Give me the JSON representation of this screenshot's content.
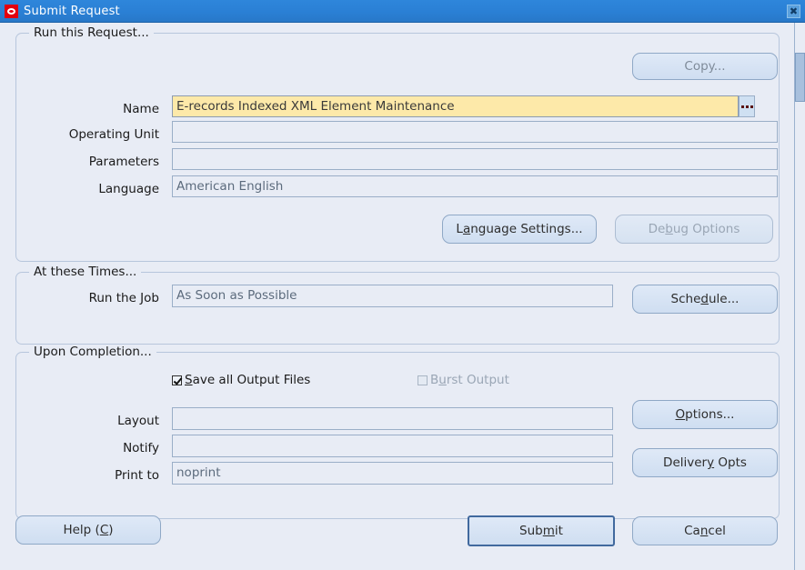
{
  "window": {
    "title": "Submit Request",
    "icon": "oracle-logo-icon",
    "close_label": "✖"
  },
  "run_request": {
    "legend": "Run this Request...",
    "copy_button": "Copy...",
    "fields": [
      {
        "label": "Name",
        "value": "E-records Indexed XML Element Maintenance",
        "focused": true,
        "has_lov": true
      },
      {
        "label": "Operating Unit",
        "value": "",
        "focused": false,
        "has_lov": false
      },
      {
        "label": "Parameters",
        "value": "",
        "focused": false,
        "has_lov": false
      },
      {
        "label": "Language",
        "value": "American English",
        "focused": false,
        "has_lov": false
      }
    ],
    "language_settings_button": {
      "pre": "L",
      "mnemonic": "a",
      "post": "nguage Settings..."
    },
    "debug_options_button": {
      "pre": "De",
      "mnemonic": "b",
      "post": "ug Options",
      "enabled": false
    }
  },
  "at_these_times": {
    "legend": "At these Times...",
    "run_the_job_label": "Run the Job",
    "run_the_job_value": "As Soon as Possible",
    "schedule_button": {
      "pre": "Sche",
      "mnemonic": "d",
      "post": "ule..."
    }
  },
  "upon_completion": {
    "legend": "Upon Completion...",
    "save_all_output_files": {
      "pre": "",
      "mnemonic": "S",
      "post": "ave all Output Files",
      "checked": true,
      "enabled": true
    },
    "burst_output": {
      "pre": "B",
      "mnemonic": "u",
      "post": "rst Output",
      "checked": false,
      "enabled": false
    },
    "fields": [
      {
        "label": "Layout",
        "value": ""
      },
      {
        "label": "Notify",
        "value": ""
      },
      {
        "label": "Print to",
        "value": "noprint"
      }
    ],
    "options_button": {
      "pre": "",
      "mnemonic": "O",
      "post": "ptions..."
    },
    "delivery_opts_button": {
      "pre": "Deliver",
      "mnemonic": "y",
      "post": " Opts"
    }
  },
  "footer": {
    "help_button": {
      "pre": "Help (",
      "mnemonic": "C",
      "post": ")"
    },
    "submit_button": {
      "pre": "Sub",
      "mnemonic": "m",
      "post": "it"
    },
    "cancel_button": {
      "pre": "Ca",
      "mnemonic": "n",
      "post": "cel"
    }
  },
  "colors": {
    "titlebar": "#2a7fd4",
    "canvas": "#e8ecf5",
    "focused_field": "#fde9a9",
    "button": "#d2e0f2",
    "group_border": "#b7c6dc",
    "logo_red": "#e2000f"
  }
}
